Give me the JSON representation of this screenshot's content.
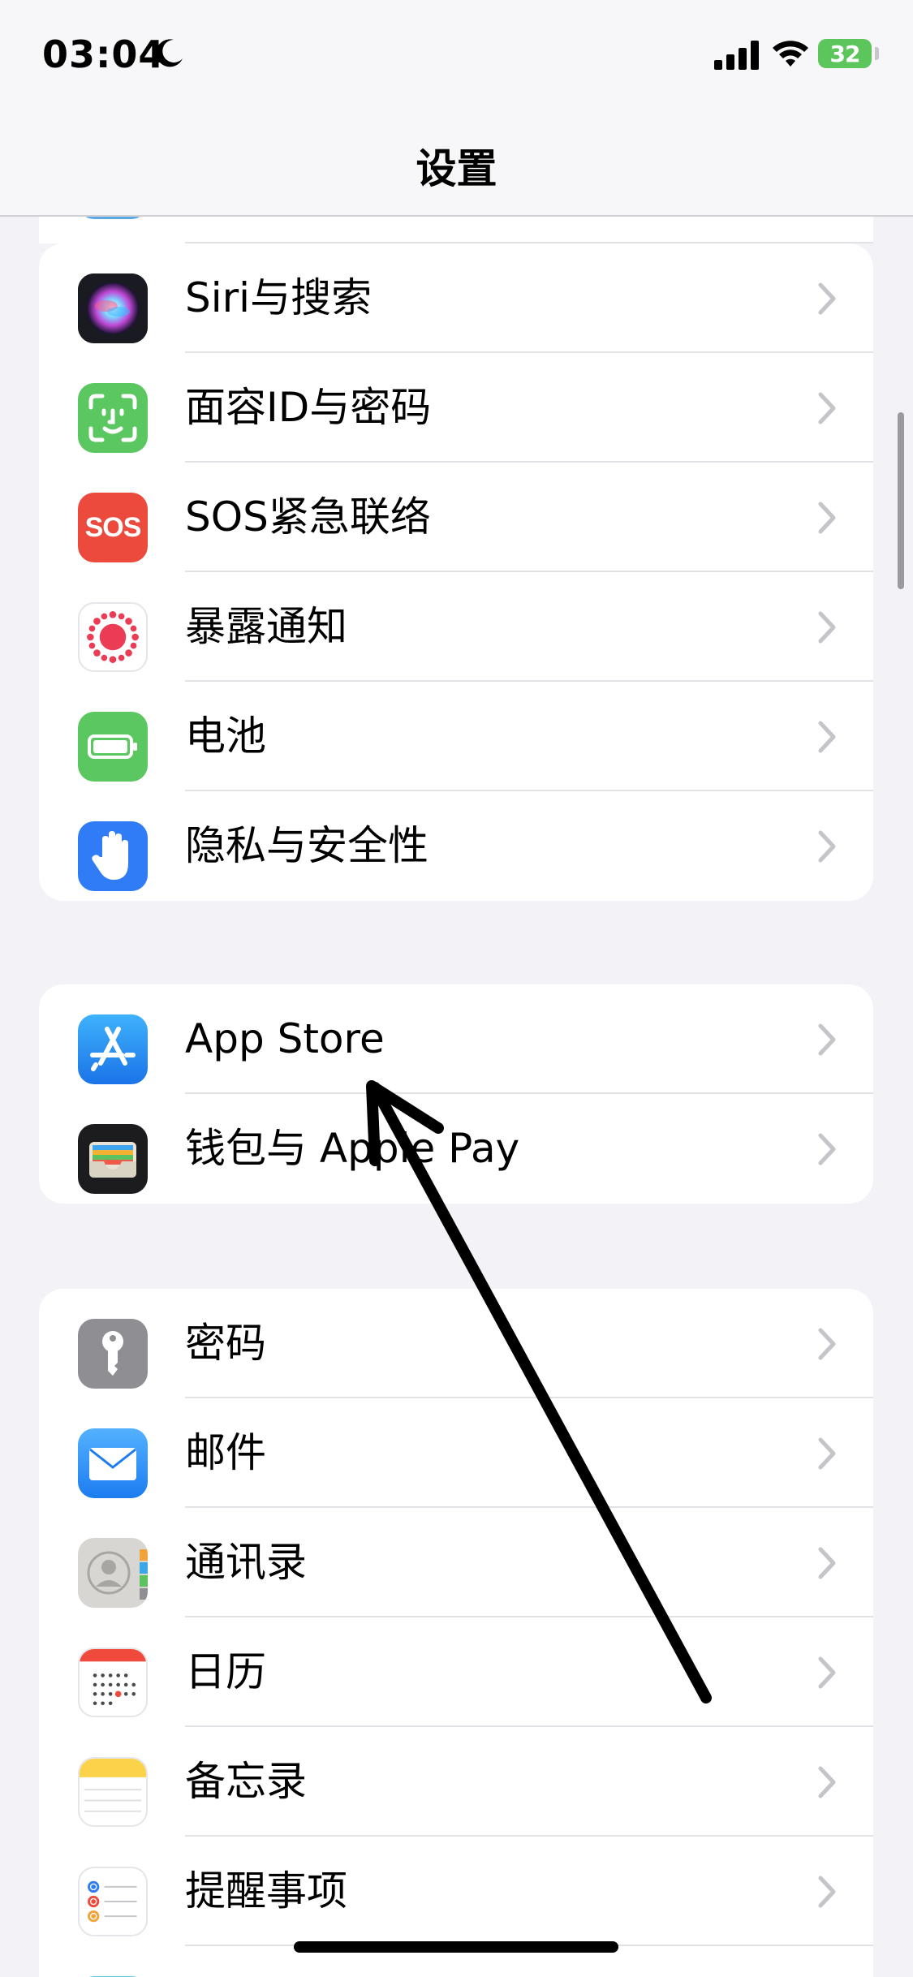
{
  "status_bar": {
    "time": "03:04",
    "battery": "32"
  },
  "nav": {
    "title": "设置"
  },
  "group1": [
    {
      "label": "Siri与搜索",
      "icon": "siri-icon"
    },
    {
      "label": "面容ID与密码",
      "icon": "face-id-icon"
    },
    {
      "label": "SOS紧急联络",
      "icon": "sos-icon",
      "icon_text": "SOS"
    },
    {
      "label": "暴露通知",
      "icon": "exposure-icon"
    },
    {
      "label": "电池",
      "icon": "battery-icon"
    },
    {
      "label": "隐私与安全性",
      "icon": "hand-icon"
    }
  ],
  "group2": [
    {
      "label": "App Store",
      "icon": "app-store-icon"
    },
    {
      "label": "钱包与 Apple Pay",
      "icon": "wallet-icon"
    }
  ],
  "group3": [
    {
      "label": "密码",
      "icon": "key-icon"
    },
    {
      "label": "邮件",
      "icon": "mail-icon"
    },
    {
      "label": "通讯录",
      "icon": "contacts-icon"
    },
    {
      "label": "日历",
      "icon": "calendar-icon"
    },
    {
      "label": "备忘录",
      "icon": "notes-icon"
    },
    {
      "label": "提醒事项",
      "icon": "reminders-icon"
    }
  ],
  "colors": {
    "background": "#f2f2f7",
    "face_id": "#5bc760",
    "sos": "#eb4a3c",
    "battery": "#5bc760",
    "privacy": "#2f7cf6",
    "app_store": "#2f8ef8",
    "wallet": "#1c1c1e",
    "key": "#8e8e93",
    "mail": "#2d8cf5",
    "chevron": "#c4c4c9"
  }
}
